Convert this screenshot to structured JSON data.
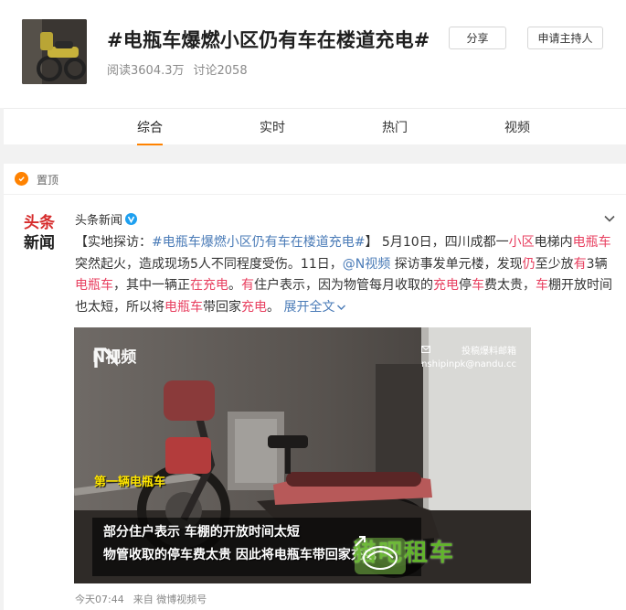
{
  "topic": {
    "title": "#电瓶车爆燃小区仍有车在楼道充电#",
    "reads": "阅读3604.3万",
    "discussions": "讨论2058",
    "share_label": "分享",
    "apply_host_label": "申请主持人"
  },
  "tabs": [
    {
      "label": "综合",
      "active": true
    },
    {
      "label": "实时",
      "active": false
    },
    {
      "label": "热门",
      "active": false
    },
    {
      "label": "视频",
      "active": false
    }
  ],
  "post": {
    "pin_label": "置顶",
    "avatar_text": [
      "头条",
      "新闻"
    ],
    "author": "头条新闻",
    "body": [
      {
        "t": "【实地探访：",
        "c": ""
      },
      {
        "t": "#电瓶车爆燃小区仍有车在楼道充电#",
        "c": "lk"
      },
      {
        "t": "】 5月10日，四川成都一",
        "c": ""
      },
      {
        "t": "小区",
        "c": "hl"
      },
      {
        "t": "电梯内",
        "c": ""
      },
      {
        "t": "电瓶车",
        "c": "hl"
      },
      {
        "t": "突然起火，造成现场5人不同程度受伤。11日，",
        "c": ""
      },
      {
        "t": "@N视频",
        "c": "lk"
      },
      {
        "t": " 探访事发单元楼，发现",
        "c": ""
      },
      {
        "t": "仍",
        "c": "hl"
      },
      {
        "t": "至少放",
        "c": ""
      },
      {
        "t": "有",
        "c": "hl"
      },
      {
        "t": "3辆",
        "c": ""
      },
      {
        "t": "电瓶车",
        "c": "hl"
      },
      {
        "t": "，其中一辆正",
        "c": ""
      },
      {
        "t": "在充电",
        "c": "hl"
      },
      {
        "t": "。",
        "c": ""
      },
      {
        "t": "有",
        "c": "hl"
      },
      {
        "t": "住户表示，因为物管每月收取的",
        "c": ""
      },
      {
        "t": "充电",
        "c": "hl"
      },
      {
        "t": "停",
        "c": ""
      },
      {
        "t": "车",
        "c": "hl"
      },
      {
        "t": "费太贵，",
        "c": ""
      },
      {
        "t": "车",
        "c": "hl"
      },
      {
        "t": "棚开放时间也太短，所以将",
        "c": ""
      },
      {
        "t": "电瓶车",
        "c": "hl"
      },
      {
        "t": "带回家",
        "c": ""
      },
      {
        "t": "充电",
        "c": "hl"
      },
      {
        "t": "。 ",
        "c": ""
      },
      {
        "t": "展开全文",
        "c": "lk"
      }
    ],
    "media": {
      "brand": "N视频",
      "submit_line1": "投稿爆料邮箱",
      "submit_line2": "nshipinpk@nandu.cc",
      "caption": "第一辆电瓶车",
      "subtitle1": "部分住户表示 车棚的开放时间太短",
      "subtitle2": "物管收取的停车费太贵 因此将电瓶车带回家充电",
      "watermark": "猎吧租车"
    },
    "time": "今天07:44",
    "source": "来自 微博视频号"
  },
  "colors": {
    "accent": "#ff8200",
    "highlight": "#e84060",
    "link": "#4a7bb7",
    "verified": "#1ea0f0"
  }
}
